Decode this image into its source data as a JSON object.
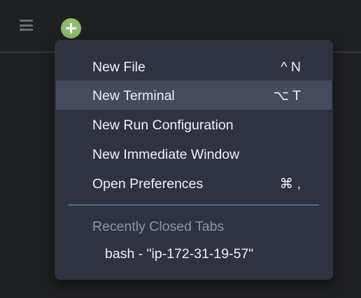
{
  "toolbar": {
    "menu_icon": "hamburger-icon",
    "add_icon": "plus-circle-icon",
    "add_color": "#8fba6b"
  },
  "menu": {
    "items": [
      {
        "label": "New File",
        "shortcut": "^ N"
      },
      {
        "label": "New Terminal",
        "shortcut": "⌥ T",
        "highlighted": true
      },
      {
        "label": "New Run Configuration",
        "shortcut": ""
      },
      {
        "label": "New Immediate Window",
        "shortcut": ""
      },
      {
        "label": "Open Preferences",
        "shortcut": "⌘ ,"
      }
    ],
    "recent_header": "Recently Closed Tabs",
    "recent_tabs": [
      {
        "label": "bash - \"ip-172-31-19-57\""
      }
    ]
  },
  "colors": {
    "menu_background": "#2f3340",
    "highlight": "#454a5c",
    "separator": "#4d6d86"
  }
}
